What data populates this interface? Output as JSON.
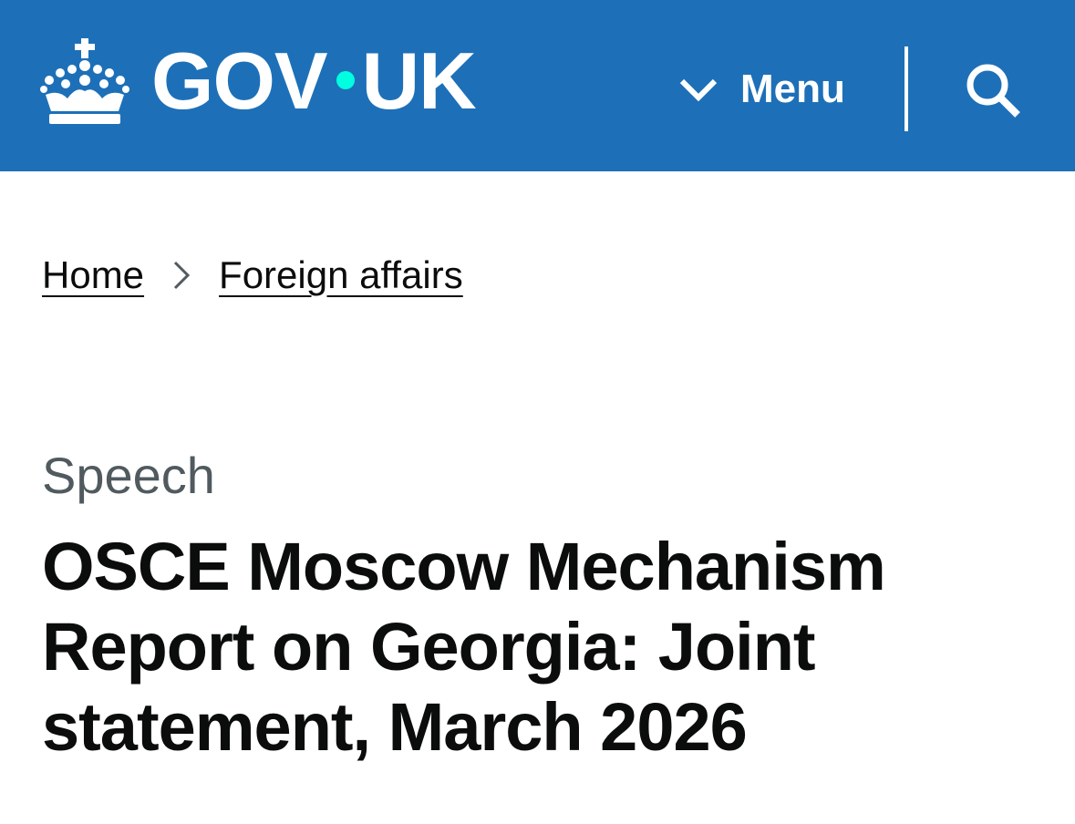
{
  "colors": {
    "header_bg": "#1d70b8",
    "brand_dot": "#00ffe0",
    "text": "#0b0c0c",
    "secondary_text": "#505a5f"
  },
  "header": {
    "logo_icon": "crown-icon",
    "logo_text_left": "GOV",
    "logo_text_right": "UK",
    "menu_label": "Menu",
    "menu_icon": "chevron-down-icon",
    "search_icon": "search-icon"
  },
  "breadcrumb": {
    "items": [
      {
        "label": "Home"
      },
      {
        "label": "Foreign affairs"
      }
    ],
    "separator_icon": "chevron-right-icon"
  },
  "main": {
    "doc_type": "Speech",
    "title": "OSCE Moscow Mechanism Report on Georgia: Joint statement, March 2026"
  }
}
